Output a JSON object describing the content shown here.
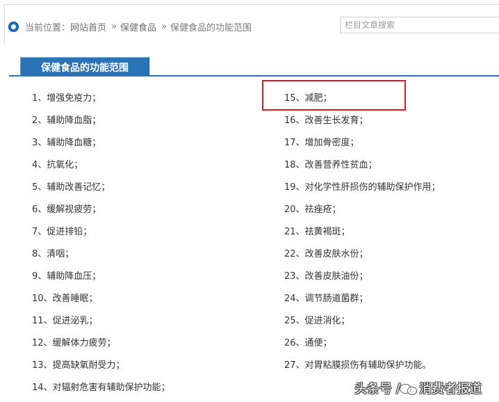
{
  "header": {
    "breadcrumb": {
      "label": "当前位置：",
      "items": [
        "网站首页",
        "保健食品",
        "保健食品的功能范围"
      ],
      "separator": "»"
    },
    "search": {
      "placeholder": "栏目文章搜索",
      "value": ""
    }
  },
  "section": {
    "title": "保健食品的功能范围"
  },
  "functions": {
    "left": [
      "1、增强免疫力；",
      "2、辅助降血脂；",
      "3、辅助降血糖；",
      "4、抗氧化；",
      "5、辅助改善记忆；",
      "6、缓解视疲劳；",
      "7、促进排铅；",
      "8、清咽；",
      "9、辅助降血压；",
      "10、改善睡眠；",
      "11、促进泌乳；",
      "12、缓解体力疲劳；",
      "13、提高缺氧耐受力；",
      "14、对辐射危害有辅助保护功能；"
    ],
    "right": [
      "15、减肥；",
      "16、改善生长发育；",
      "17、增加骨密度；",
      "18、改善营养性贫血；",
      "19、对化学性肝损伤的辅助保护作用；",
      "20、祛痤疮；",
      "21、祛黄褐斑；",
      "22、改善皮肤水份；",
      "23、改善皮肤油份；",
      "24、调节肠道菌群；",
      "25、促进消化；",
      "26、通便；",
      "27、对胃粘膜损伤有辅助保护功能。"
    ]
  },
  "watermark": {
    "source": "头条号",
    "slash": "/",
    "brand": "消费者报道"
  },
  "colors": {
    "accent": "#2a73b7",
    "highlight": "#e3191a",
    "text": "#333333",
    "muted": "#7b7b7b"
  },
  "icons": {
    "location": "location-icon",
    "watermark": "wechat-bubble-icon"
  }
}
